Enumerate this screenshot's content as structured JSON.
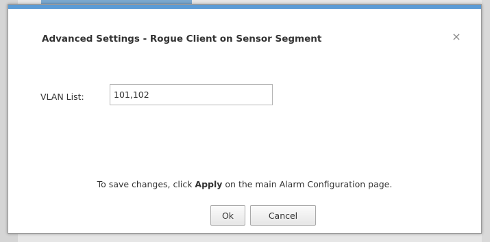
{
  "dialog": {
    "title": "Advanced Settings - Rogue Client on Sensor Segment",
    "close_glyph": "×",
    "close_icon": "close-icon"
  },
  "form": {
    "vlan_label": "VLAN List:",
    "vlan_value": "101,102"
  },
  "note": {
    "prefix": "To save changes, click ",
    "emphasis": "Apply",
    "suffix": " on the main Alarm Configuration page."
  },
  "buttons": {
    "ok_label": "Ok",
    "cancel_label": "Cancel"
  },
  "colors": {
    "accent": "#5b9bd5"
  }
}
